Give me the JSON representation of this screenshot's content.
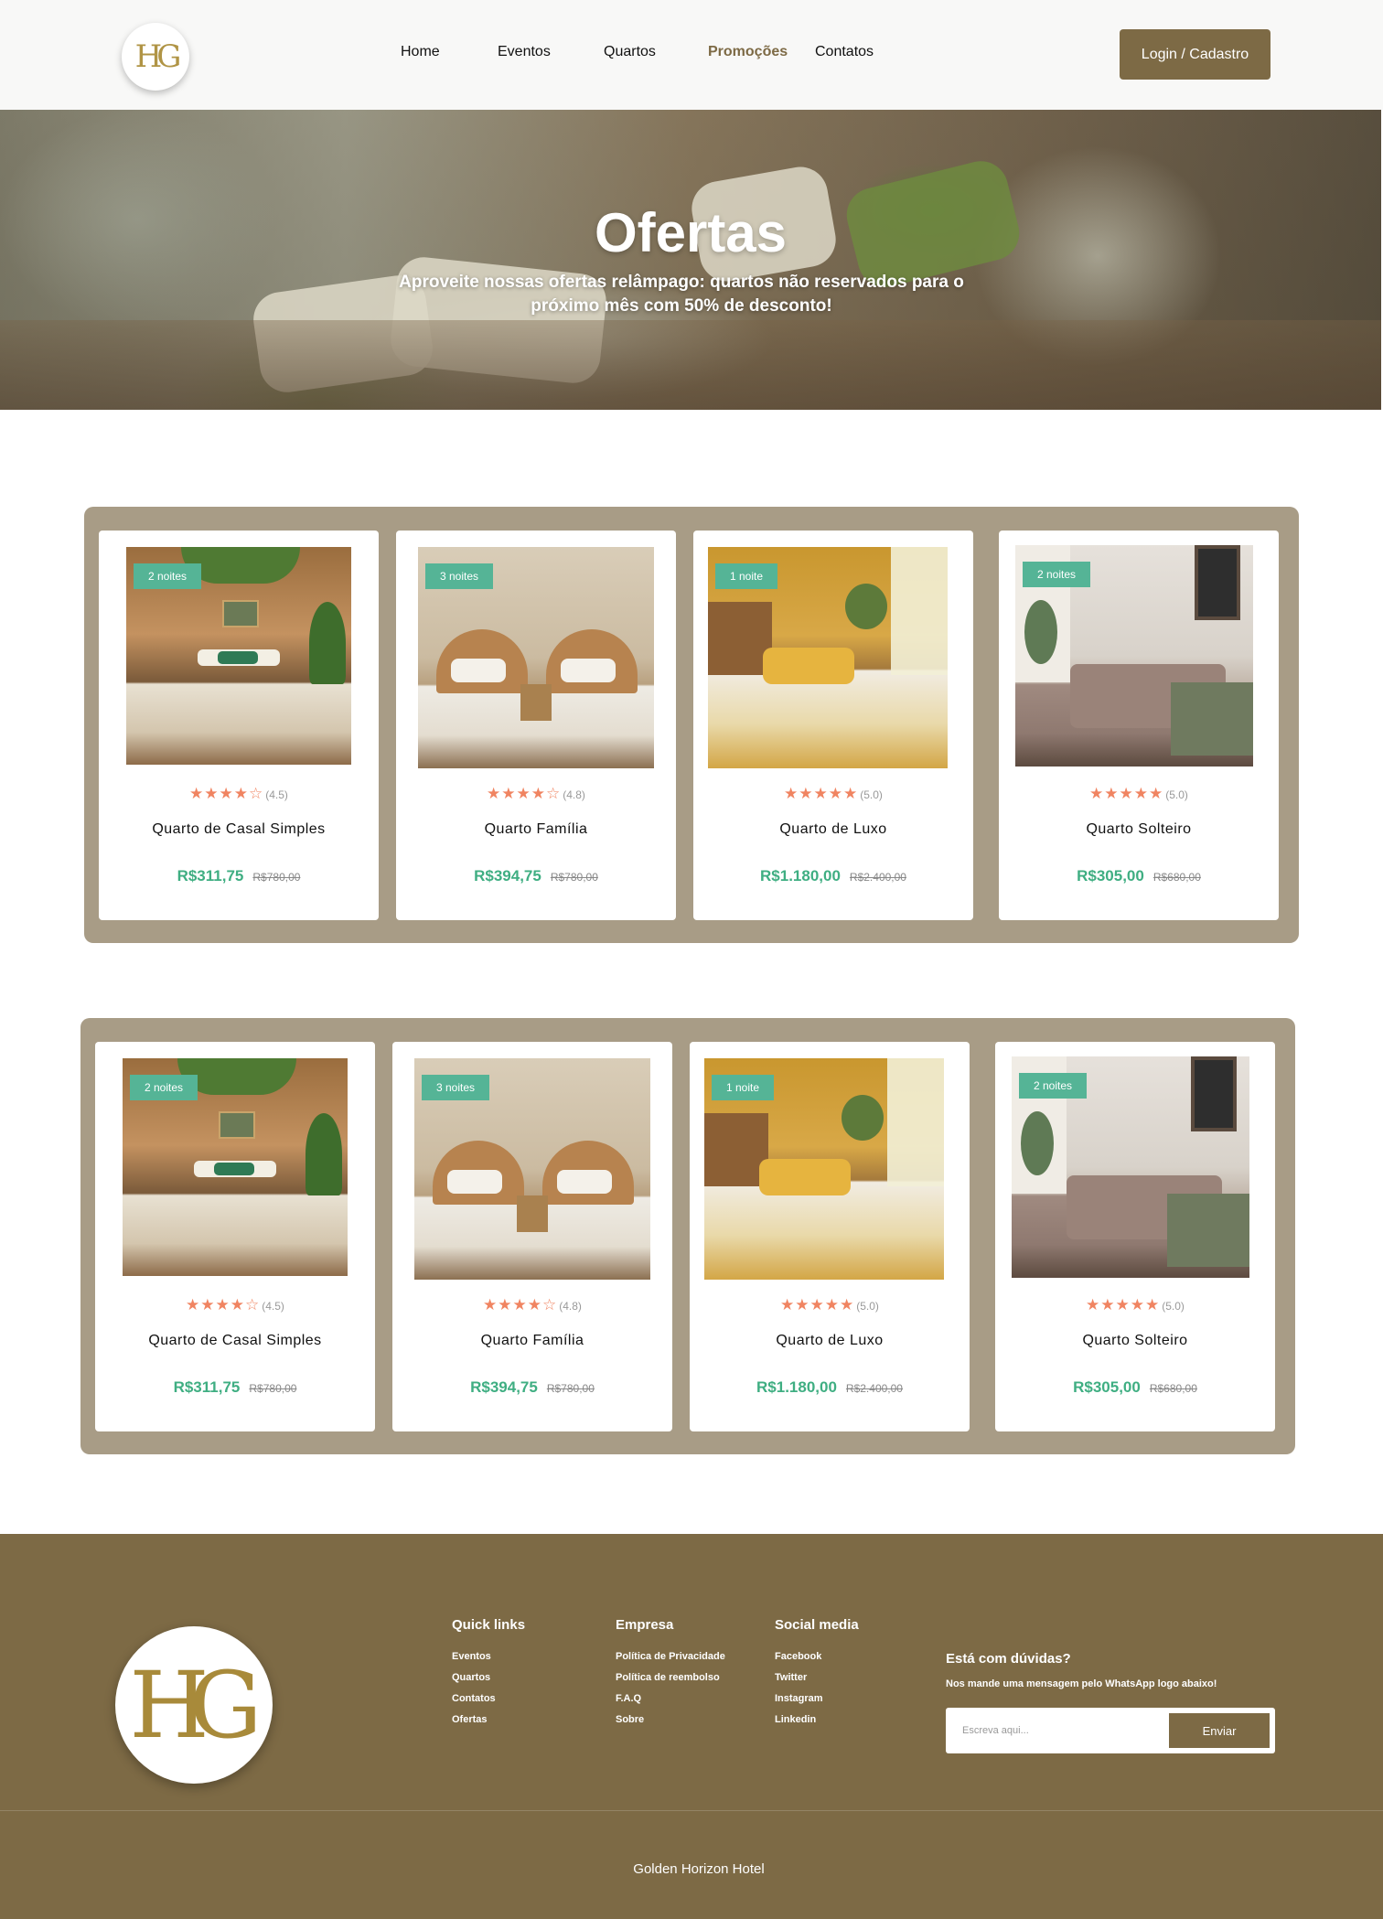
{
  "header": {
    "logo_text": "HG",
    "nav": [
      {
        "label": "Home",
        "active": false
      },
      {
        "label": "Eventos",
        "active": false
      },
      {
        "label": "Quartos",
        "active": false
      },
      {
        "label": "Promoções",
        "active": true
      },
      {
        "label": "Contatos",
        "active": false
      }
    ],
    "login_label": "Login / Cadastro"
  },
  "hero": {
    "title": "Ofertas",
    "subtitle": "Aproveite nossas ofertas relâmpago: quartos não reservados para o próximo mês com 50% de desconto!"
  },
  "offers": [
    {
      "cards": [
        {
          "badge": "2 noites",
          "stars": "★★★★☆",
          "rating": "(4.5)",
          "title": "Quarto de Casal Simples",
          "price": "R$311,75",
          "old_price": "R$780,00",
          "image": "double-room-photo"
        },
        {
          "badge": "3 noites",
          "stars": "★★★★☆",
          "rating": "(4.8)",
          "title": "Quarto Família",
          "price": "R$394,75",
          "old_price": "R$780,00",
          "image": "family-room-photo"
        },
        {
          "badge": "1 noite",
          "stars": "★★★★★",
          "rating": "(5.0)",
          "title": "Quarto de Luxo",
          "price": "R$1.180,00",
          "old_price": "R$2.400,00",
          "image": "luxury-room-photo"
        },
        {
          "badge": "2 noites",
          "stars": "★★★★★",
          "rating": "(5.0)",
          "title": "Quarto Solteiro",
          "price": "R$305,00",
          "old_price": "R$680,00",
          "image": "single-room-photo"
        }
      ]
    },
    {
      "cards": [
        {
          "badge": "2 noites",
          "stars": "★★★★☆",
          "rating": "(4.5)",
          "title": "Quarto de Casal Simples",
          "price": "R$311,75",
          "old_price": "R$780,00",
          "image": "double-room-photo"
        },
        {
          "badge": "3 noites",
          "stars": "★★★★☆",
          "rating": "(4.8)",
          "title": "Quarto Família",
          "price": "R$394,75",
          "old_price": "R$780,00",
          "image": "family-room-photo"
        },
        {
          "badge": "1 noite",
          "stars": "★★★★★",
          "rating": "(5.0)",
          "title": "Quarto de Luxo",
          "price": "R$1.180,00",
          "old_price": "R$2.400,00",
          "image": "luxury-room-photo"
        },
        {
          "badge": "2 noites",
          "stars": "★★★★★",
          "rating": "(5.0)",
          "title": "Quarto Solteiro",
          "price": "R$305,00",
          "old_price": "R$680,00",
          "image": "single-room-photo"
        }
      ]
    }
  ],
  "footer": {
    "logo_text": "HG",
    "quick_links": {
      "title": "Quick links",
      "items": [
        "Eventos",
        "Quartos",
        "Contatos",
        "Ofertas"
      ]
    },
    "company": {
      "title": "Empresa",
      "items": [
        "Política de Privacidade",
        "Política de reembolso",
        "F.A.Q",
        "Sobre"
      ]
    },
    "social": {
      "title": "Social media",
      "items": [
        "Facebook",
        "Twitter",
        "Instagram",
        "Linkedin"
      ]
    },
    "contact": {
      "title": "Está com dúvidas?",
      "text": "Nos mande uma mensagem pelo WhatsApp logo abaixo!",
      "placeholder": "Escreva aqui...",
      "send_label": "Enviar"
    },
    "brand": "Golden Horizon Hotel"
  },
  "colors": {
    "brand": "#7d6a45",
    "panel": "#a89c86",
    "badge": "#55b496",
    "price": "#3fae82",
    "stars": "#f08461"
  }
}
